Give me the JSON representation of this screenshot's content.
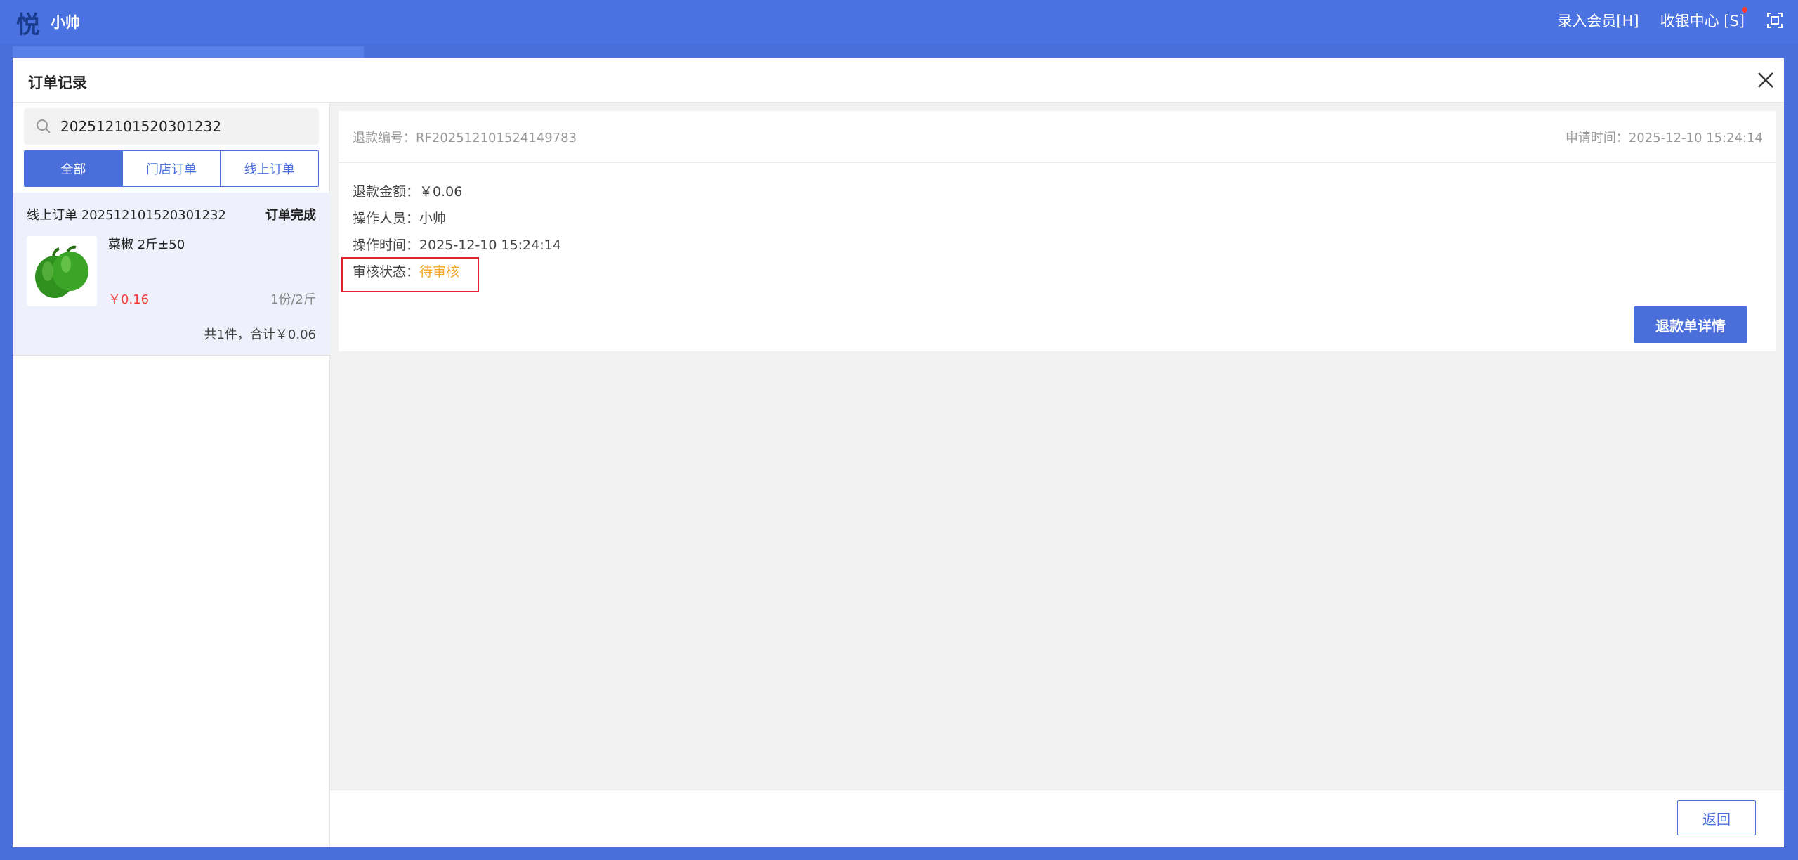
{
  "topbar": {
    "logo_char": "悦",
    "username": "小帅",
    "register_member": "录入会员[H]",
    "cashier_center": "收银中心 [S]"
  },
  "modal": {
    "title": "订单记录"
  },
  "search": {
    "value": "202512101520301232"
  },
  "tabs": [
    {
      "label": "全部"
    },
    {
      "label": "门店订单"
    },
    {
      "label": "线上订单"
    }
  ],
  "order": {
    "number": "线上订单 202512101520301232",
    "status": "订单完成",
    "product_name": "菜椒 2斤±50",
    "price": "￥0.16",
    "qty": "1份/2斤",
    "total": "共1件，合计￥0.06"
  },
  "refund": {
    "no_label": "退款编号：",
    "no_value": "RF202512101524149783",
    "apply_label": "申请时间：",
    "apply_value": "2025-12-10 15:24:14",
    "amount_label": "退款金额：",
    "amount_value": "￥0.06",
    "operator_label": "操作人员：",
    "operator_value": "小帅",
    "optime_label": "操作时间：",
    "optime_value": "2025-12-10 15:24:14",
    "audit_label": "审核状态：",
    "audit_value": "待审核",
    "detail_button": "退款单详情"
  },
  "footer": {
    "back_button": "返回"
  },
  "colors": {
    "primary": "#4a6fdb",
    "pending": "#f5a623",
    "price": "#f03c3c",
    "highlight_frame": "#e0242c"
  }
}
